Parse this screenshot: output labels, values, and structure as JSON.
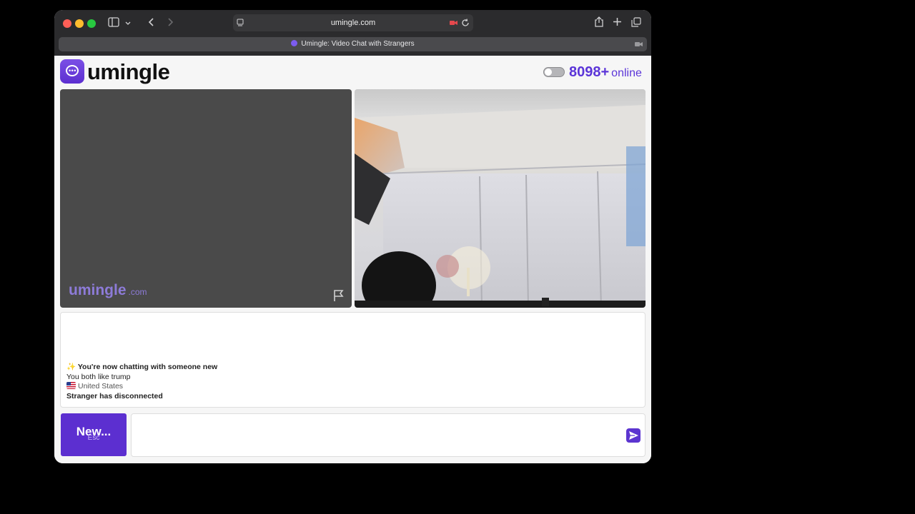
{
  "browser": {
    "url": "umingle.com",
    "tab_title": "Umingle: Video Chat with Strangers"
  },
  "header": {
    "logo_text": "umingle",
    "online_count": "8098+",
    "online_label": "online",
    "toggle_on": false
  },
  "video": {
    "watermark_main": "umingle",
    "watermark_domain": ".com"
  },
  "chat": {
    "new_chat_prefix": "✨",
    "new_chat_text": "You're now chatting with someone new",
    "interest_line": "You both like trump",
    "country": "United States",
    "disconnect_text": "Stranger has disconnected"
  },
  "controls": {
    "new_button_label": "New...",
    "new_button_hint": "Esc",
    "message_value": ""
  },
  "colors": {
    "brand": "#5c2fd0",
    "accent_text": "#5b35d8"
  }
}
